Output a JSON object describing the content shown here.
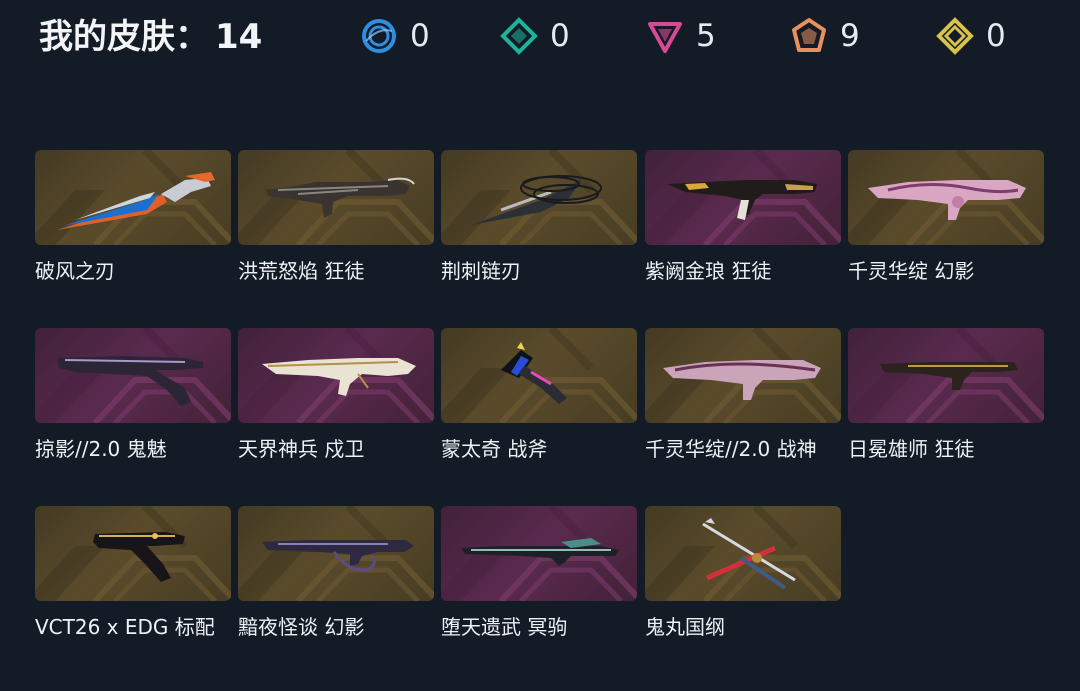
{
  "header": {
    "title": "我的皮肤：",
    "count": "14"
  },
  "rarities": [
    {
      "name": "select-tier-icon",
      "color": "#2f8de4",
      "count": "0"
    },
    {
      "name": "deluxe-tier-icon",
      "color": "#1fb39a",
      "count": "0"
    },
    {
      "name": "premium-tier-icon",
      "color": "#d64a93",
      "count": "5"
    },
    {
      "name": "exclusive-tier-icon",
      "color": "#e8905e",
      "count": "9"
    },
    {
      "name": "ultra-tier-icon",
      "color": "#d8c24a",
      "count": "0"
    }
  ],
  "skins": [
    {
      "label": "破风之刃",
      "tier": "exclusive",
      "weapon": "knife"
    },
    {
      "label": "洪荒怒焰 狂徒",
      "tier": "exclusive",
      "weapon": "rifle-dark"
    },
    {
      "label": "荆刺链刃",
      "tier": "exclusive",
      "weapon": "blade"
    },
    {
      "label": "紫阙金琅 狂徒",
      "tier": "premium",
      "weapon": "rifle-gold"
    },
    {
      "label": "千灵华绽 幻影",
      "tier": "exclusive",
      "weapon": "rifle-pink"
    },
    {
      "label": "掠影//2.0 鬼魅",
      "tier": "premium",
      "weapon": "pistol-purple"
    },
    {
      "label": "天界神兵 戍卫",
      "tier": "premium",
      "weapon": "rifle-white"
    },
    {
      "label": "蒙太奇 战斧",
      "tier": "exclusive",
      "weapon": "axe"
    },
    {
      "label": "千灵华绽//2.0 战神",
      "tier": "exclusive",
      "weapon": "rifle-rose"
    },
    {
      "label": "日冕雄师 狂徒",
      "tier": "premium",
      "weapon": "rifle-black"
    },
    {
      "label": "VCT26 x EDG 标配",
      "tier": "exclusive",
      "weapon": "pistol-gold"
    },
    {
      "label": "黯夜怪谈 幻影",
      "tier": "exclusive",
      "weapon": "rifle-purple"
    },
    {
      "label": "堕天遗武 冥驹",
      "tier": "premium",
      "weapon": "sniper"
    },
    {
      "label": "鬼丸国纲",
      "tier": "exclusive",
      "weapon": "katana"
    }
  ]
}
